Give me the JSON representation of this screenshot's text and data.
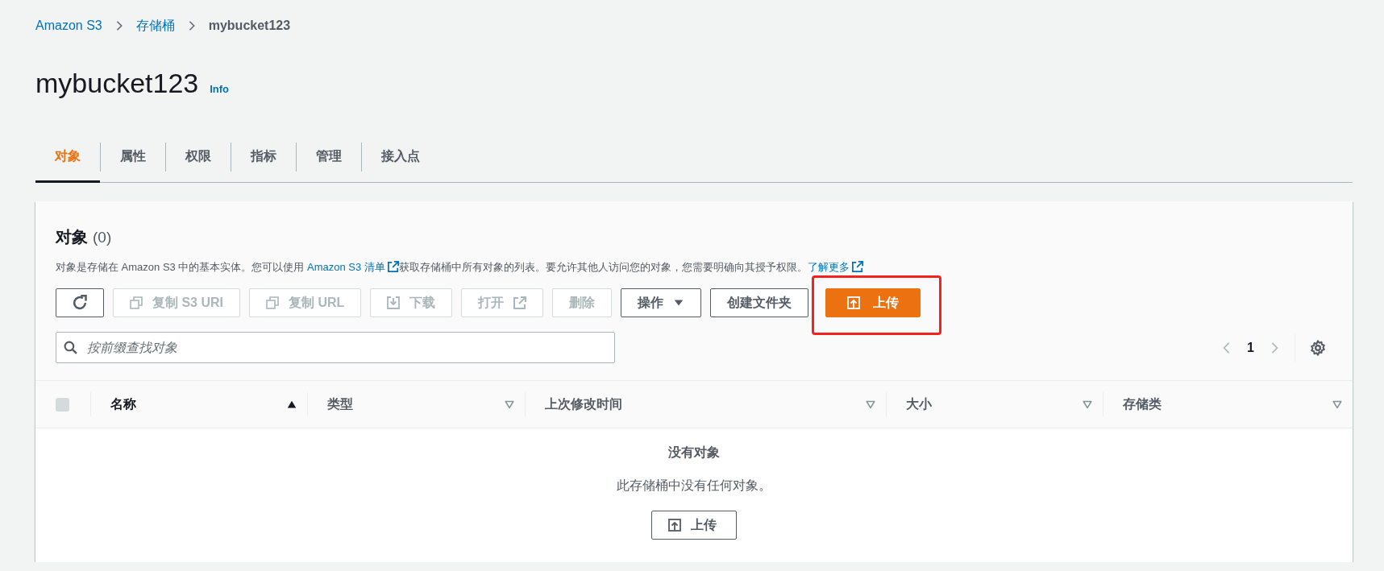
{
  "breadcrumb": [
    {
      "label": "Amazon S3",
      "link": true
    },
    {
      "label": "存储桶",
      "link": true
    },
    {
      "label": "mybucket123",
      "link": false
    }
  ],
  "page": {
    "title": "mybucket123",
    "info_link": "Info"
  },
  "tabs": [
    {
      "label": "对象",
      "selected": true
    },
    {
      "label": "属性",
      "selected": false
    },
    {
      "label": "权限",
      "selected": false
    },
    {
      "label": "指标",
      "selected": false
    },
    {
      "label": "管理",
      "selected": false
    },
    {
      "label": "接入点",
      "selected": false
    }
  ],
  "objects_panel": {
    "title": "对象",
    "count": "(0)",
    "description": [
      {
        "kind": "text",
        "text": "对象是存储在 Amazon S3 中的基本实体。您可以使用 "
      },
      {
        "kind": "external_link",
        "text": "Amazon S3 清单"
      },
      {
        "kind": "text",
        "text": "获取存储桶中所有对象的列表。要允许其他人访问您的对象，您需要明确向其授予权限。"
      },
      {
        "kind": "external_link",
        "text": "了解更多"
      }
    ],
    "actions": [
      {
        "kind": "refresh",
        "disabled": false
      },
      {
        "kind": "copy",
        "label": "复制 S3 URI",
        "disabled": true
      },
      {
        "kind": "copy",
        "label": "复制 URL",
        "disabled": true
      },
      {
        "kind": "download",
        "label": "下载",
        "disabled": true
      },
      {
        "kind": "open_external",
        "label": "打开",
        "disabled": true
      },
      {
        "kind": "plain",
        "label": "删除",
        "disabled": true
      },
      {
        "kind": "dropdown",
        "label": "操作",
        "disabled": false
      },
      {
        "kind": "plain",
        "label": "创建文件夹",
        "disabled": false
      },
      {
        "kind": "upload",
        "label": "上传",
        "disabled": false,
        "primary": true,
        "highlighted": true
      }
    ],
    "search": {
      "placeholder": "按前缀查找对象"
    },
    "pagination": {
      "page": "1"
    },
    "table": {
      "select_all": {
        "checked": false
      },
      "columns": [
        {
          "label": "名称",
          "sorted": true
        },
        {
          "label": "类型",
          "sorted": false
        },
        {
          "label": "上次修改时间",
          "sorted": false
        },
        {
          "label": "大小",
          "sorted": false
        },
        {
          "label": "存储类",
          "sorted": false
        }
      ],
      "empty_state": {
        "title": "没有对象",
        "message": "此存储桶中没有任何对象。",
        "button": "上传"
      }
    }
  }
}
